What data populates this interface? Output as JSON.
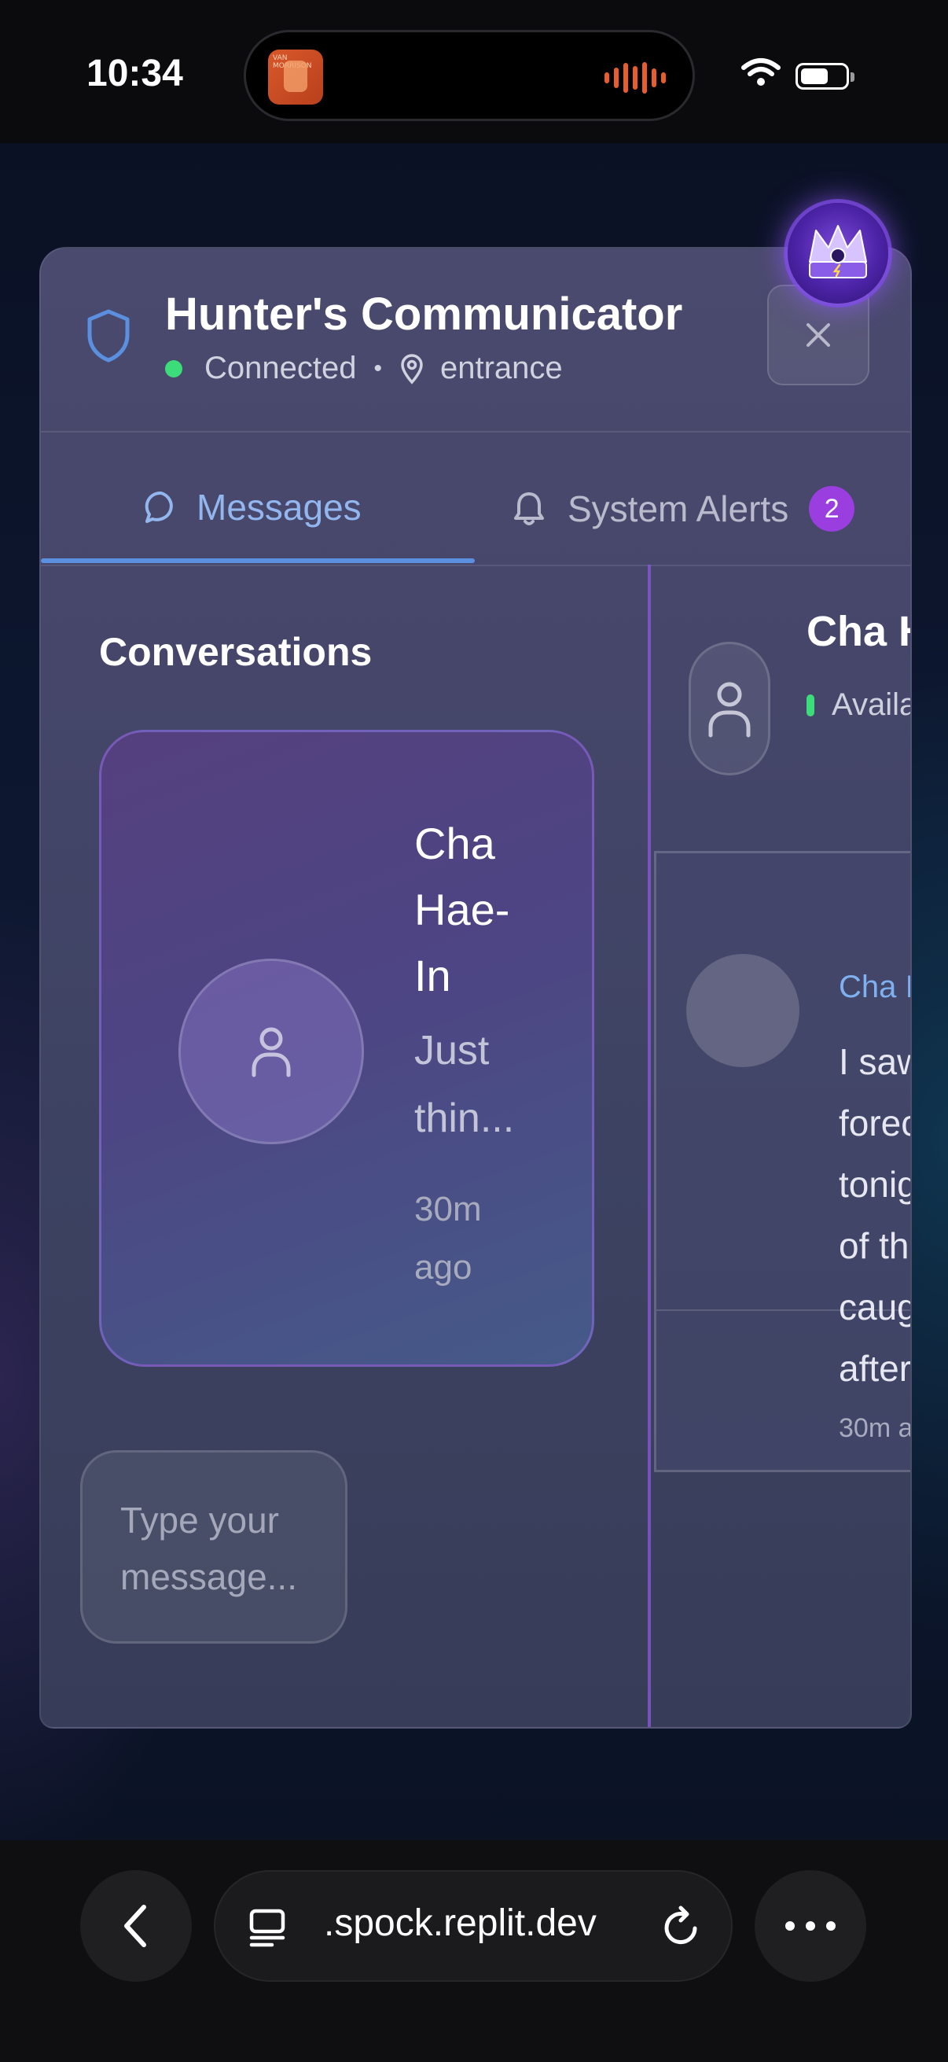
{
  "status_bar": {
    "time": "10:34"
  },
  "now_playing": {
    "album_text": "VAN MORRISON"
  },
  "header": {
    "title": "Hunter's Communicator",
    "status": "Connected",
    "separator": "•",
    "location": "entrance"
  },
  "tabs": {
    "messages_label": "Messages",
    "alerts_label": "System Alerts",
    "alerts_count": "2"
  },
  "conversations": {
    "title": "Conversations",
    "items": [
      {
        "name": "Cha Hae-In",
        "preview": "Just thin...",
        "time": "30m ago"
      }
    ]
  },
  "chat": {
    "name": "Cha H",
    "status": "Availa",
    "message": {
      "sender": "Cha I",
      "lines": [
        "I saw",
        "forec",
        "tonig",
        "of th",
        "caug",
        "after"
      ],
      "time": "30m a"
    },
    "input_placeholder": "Type your message..."
  },
  "browser": {
    "url": ".spock.replit.dev"
  },
  "colors": {
    "accent": "#5b8fe0",
    "badge": "#9a3ee0",
    "online": "#3ddc7a"
  }
}
